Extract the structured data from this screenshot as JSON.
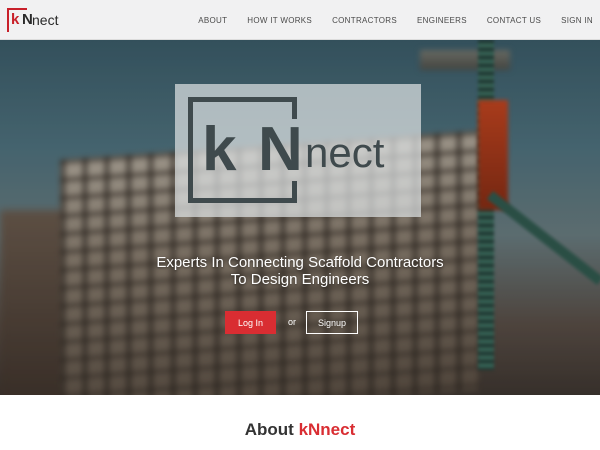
{
  "nav": {
    "logo": {
      "k": "k",
      "n": "N",
      "rest": "nect"
    },
    "links": [
      "ABOUT",
      "HOW IT WORKS",
      "CONTRACTORS",
      "ENGINEERS",
      "CONTACT US",
      "SIGN IN"
    ]
  },
  "hero": {
    "logo": {
      "k": "k",
      "n": "N",
      "rest": "nect"
    },
    "tagline_line1": "Experts In Connecting Scaffold Contractors",
    "tagline_line2": "To Design Engineers",
    "login_label": "Log In",
    "or_label": "or",
    "signup_label": "Signup"
  },
  "about": {
    "title_prefix": "About ",
    "title_brand": "kNnect"
  },
  "colors": {
    "accent": "#d92d32",
    "nav_bg": "#f1f1f2",
    "logo_dark": "#3f4a4d"
  }
}
